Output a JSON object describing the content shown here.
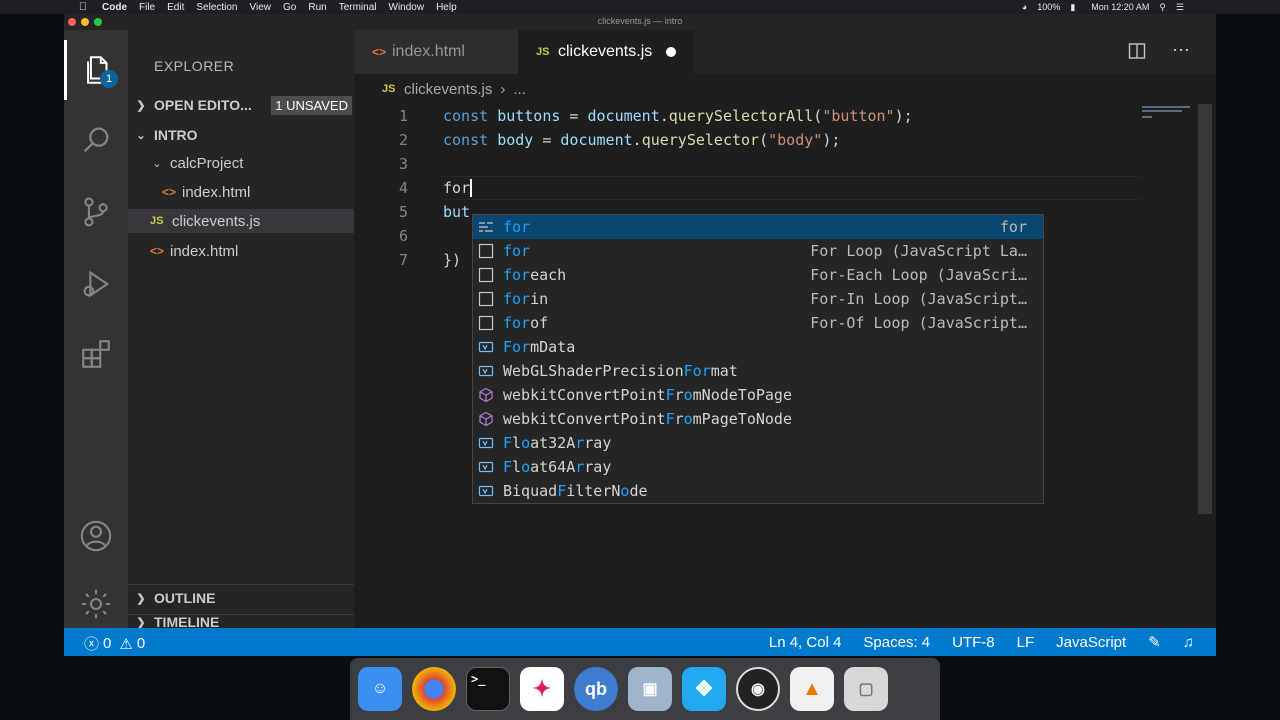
{
  "menubar": {
    "apple": "",
    "items": [
      "Code",
      "File",
      "Edit",
      "Selection",
      "View",
      "Go",
      "Run",
      "Terminal",
      "Window",
      "Help"
    ],
    "battery": "100%",
    "clock": "Mon 12:20 AM"
  },
  "window": {
    "title": "clickevents.js — intro"
  },
  "activity_bar": {
    "explorer_badge": "1"
  },
  "sidebar": {
    "title": "EXPLORER",
    "open_editors": "OPEN EDITO...",
    "unsaved_badge": "1 UNSAVED",
    "folder": "INTRO",
    "tree": {
      "calc_project": "calcProject",
      "calc_index": "index.html",
      "clickevents": "clickevents.js",
      "index": "index.html"
    },
    "outline": "OUTLINE",
    "timeline": "TIMELINE"
  },
  "tabs": {
    "inactive": "index.html",
    "active": "clickevents.js"
  },
  "breadcrumb": {
    "file": "clickevents.js",
    "sep": "›",
    "more": "..."
  },
  "editor": {
    "line_numbers": [
      "1",
      "2",
      "3",
      "4",
      "5",
      "6",
      "7"
    ],
    "line1": {
      "kw": "const",
      "var": "buttons",
      "eq": " = ",
      "obj": "document",
      "fn": "querySelectorAll",
      "str": "\"button\"",
      "end": ");"
    },
    "line2": {
      "kw": "const",
      "var": "body",
      "eq": " = ",
      "obj": "document",
      "fn": "querySelector",
      "str": "\"body\"",
      "end": ");"
    },
    "line4": "for",
    "line5": "but",
    "line7": "})"
  },
  "suggestions": [
    {
      "prefix": "for",
      "rest": "",
      "detail": "for",
      "icon": "keyword-icon"
    },
    {
      "prefix": "for",
      "rest": "",
      "detail": "For Loop (JavaScript La…",
      "icon": "snippet-icon"
    },
    {
      "prefix": "for",
      "rest": "each",
      "detail": "For-Each Loop (JavaScri…",
      "icon": "snippet-icon"
    },
    {
      "prefix": "for",
      "rest": "in",
      "detail": "For-In Loop (JavaScript…",
      "icon": "snippet-icon"
    },
    {
      "prefix": "for",
      "rest": "of",
      "detail": "For-Of Loop (JavaScript…",
      "icon": "snippet-icon"
    },
    {
      "prefix": "",
      "rest": "",
      "full": "FormData",
      "detail": "",
      "icon": "variable-icon"
    },
    {
      "prefix": "",
      "rest": "",
      "full": "WebGLShaderPrecisionFormat",
      "detail": "",
      "icon": "variable-icon"
    },
    {
      "prefix": "",
      "rest": "",
      "full": "webkitConvertPointFromNodeToPage",
      "detail": "",
      "icon": "method-icon"
    },
    {
      "prefix": "",
      "rest": "",
      "full": "webkitConvertPointFromPageToNode",
      "detail": "",
      "icon": "method-icon"
    },
    {
      "prefix": "",
      "rest": "",
      "full": "Float32Array",
      "detail": "",
      "icon": "variable-icon"
    },
    {
      "prefix": "",
      "rest": "",
      "full": "Float64Array",
      "detail": "",
      "icon": "variable-icon"
    },
    {
      "prefix": "",
      "rest": "",
      "full": "BiquadFilterNode",
      "detail": "",
      "icon": "variable-icon"
    }
  ],
  "statusbar": {
    "errors": "0",
    "warnings": "0",
    "position": "Ln 4, Col 4",
    "spaces": "Spaces: 4",
    "encoding": "UTF-8",
    "eol": "LF",
    "language": "JavaScript"
  },
  "dock": {
    "apps": [
      "finder-icon",
      "chrome-icon",
      "terminal-icon",
      "slack-icon",
      "qbittorrent-icon",
      "preview-icon",
      "vscode-icon",
      "obs-icon",
      "vlc-icon",
      "trash-icon"
    ],
    "terminal_glyph": ">_",
    "qb_glyph": "qb"
  },
  "colors": {
    "accent": "#007acc",
    "editor_bg": "#1e1e1e",
    "sidebar_bg": "#252526",
    "activity_bg": "#333333",
    "suggest_focus": "#094771",
    "match_highlight": "#18a3ff"
  }
}
